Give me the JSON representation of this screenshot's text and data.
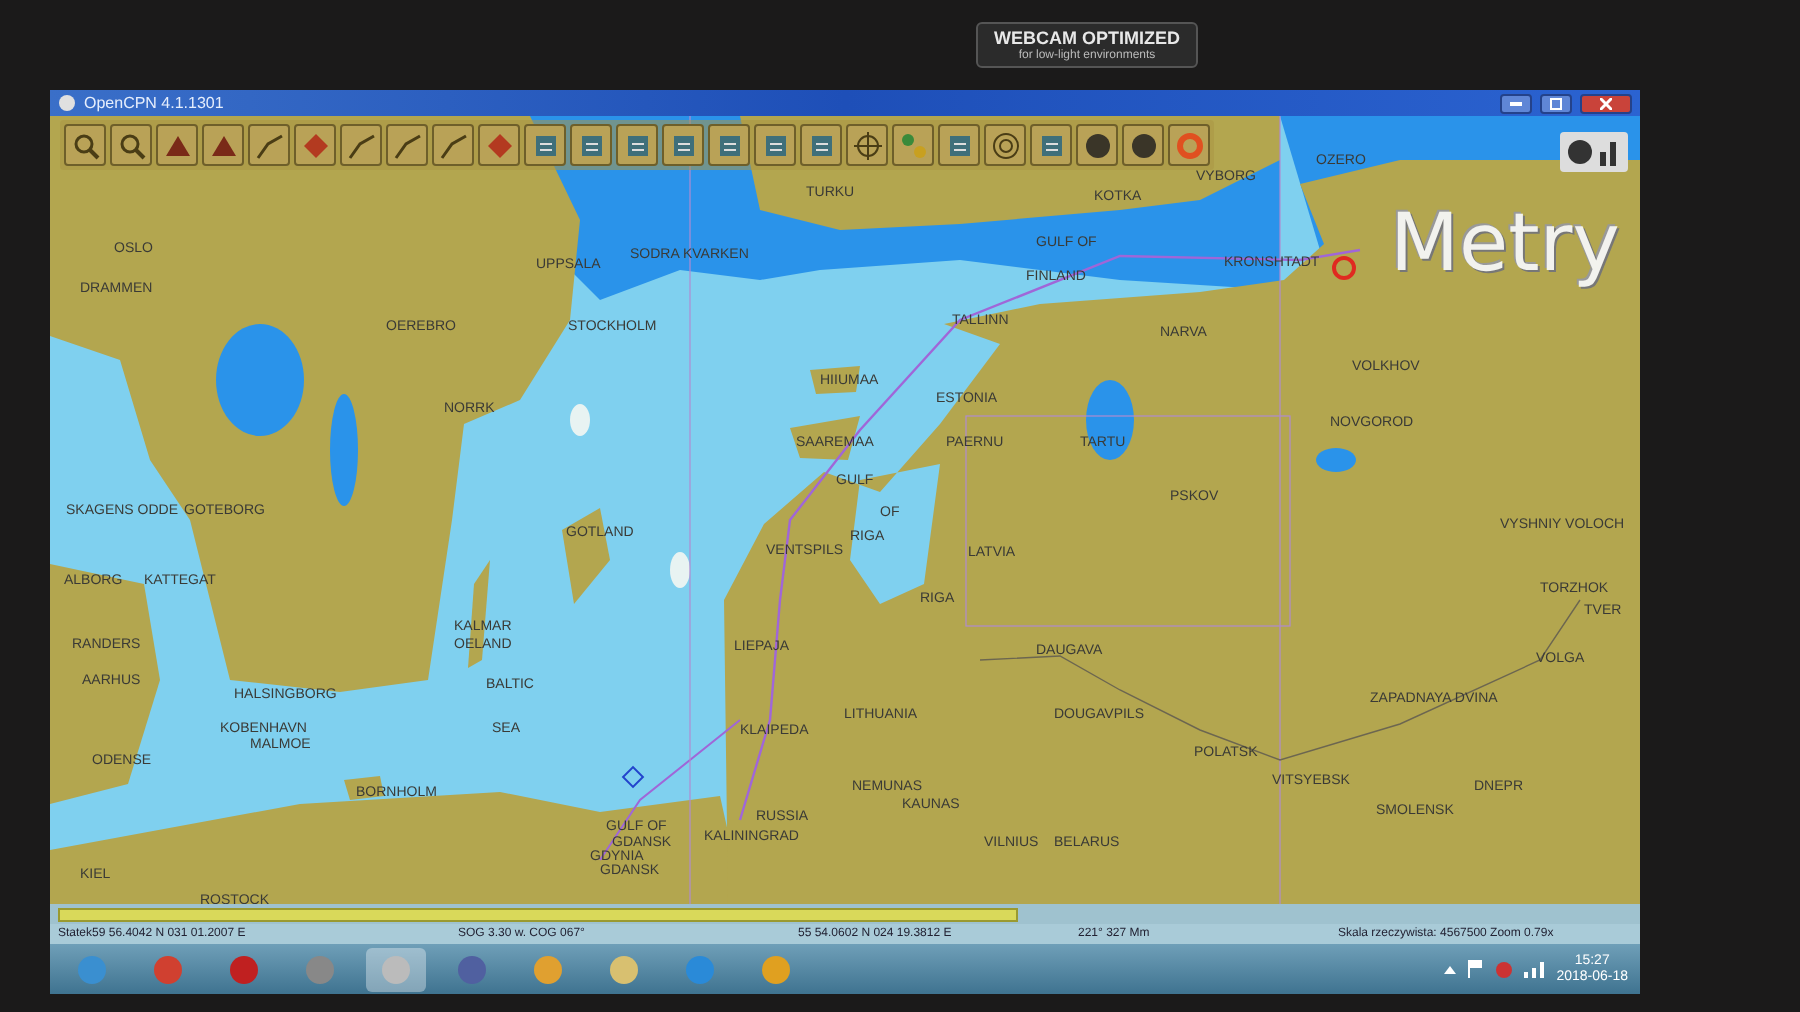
{
  "bezel": {
    "label": "WEBCAM OPTIMIZED",
    "sublabel": "for low-light environments"
  },
  "window": {
    "title": "OpenCPN 4.1.1301"
  },
  "map": {
    "overlay": "Metry",
    "labels": [
      {
        "text": "OZERO"
      },
      {
        "text": "VYBORG"
      },
      {
        "text": "TURKU"
      },
      {
        "text": "KOTKA"
      },
      {
        "text": "GULF OF"
      },
      {
        "text": "OSLO"
      },
      {
        "text": "SODRA KVARKEN"
      },
      {
        "text": "KRONSHTADT"
      },
      {
        "text": "UPPSALA"
      },
      {
        "text": "FINLAND"
      },
      {
        "text": "DRAMMEN"
      },
      {
        "text": "TALLINN"
      },
      {
        "text": "OEREBRO"
      },
      {
        "text": "STOCKHOLM"
      },
      {
        "text": "NARVA"
      },
      {
        "text": "VOLKHOV"
      },
      {
        "text": "HIIUMAA"
      },
      {
        "text": "ESTONIA"
      },
      {
        "text": "NORRK"
      },
      {
        "text": "NOVGOROD"
      },
      {
        "text": "SAAREMAA"
      },
      {
        "text": "PAERNU"
      },
      {
        "text": "TARTU"
      },
      {
        "text": "GULF"
      },
      {
        "text": "PSKOV"
      },
      {
        "text": "SKAGENS ODDE"
      },
      {
        "text": "GOTEBORG"
      },
      {
        "text": "OF"
      },
      {
        "text": "VYSHNIY VOLOCH"
      },
      {
        "text": "GOTLAND"
      },
      {
        "text": "RIGA"
      },
      {
        "text": "VENTSPILS"
      },
      {
        "text": "LATVIA"
      },
      {
        "text": "ALBORG"
      },
      {
        "text": "KATTEGAT"
      },
      {
        "text": "TORZHOK"
      },
      {
        "text": "RIGA"
      },
      {
        "text": "TVER"
      },
      {
        "text": "KALMAR"
      },
      {
        "text": "RANDERS"
      },
      {
        "text": "OELAND"
      },
      {
        "text": "LIEPAJA"
      },
      {
        "text": "DAUGAVA"
      },
      {
        "text": "VOLGA"
      },
      {
        "text": "AARHUS"
      },
      {
        "text": "BALTIC"
      },
      {
        "text": "HALSINGBORG"
      },
      {
        "text": "ZAPADNAYA DVINA"
      },
      {
        "text": "LITHUANIA"
      },
      {
        "text": "DOUGAVPILS"
      },
      {
        "text": "KOBENHAVN"
      },
      {
        "text": "SEA"
      },
      {
        "text": "KLAIPEDA"
      },
      {
        "text": "MALMOE"
      },
      {
        "text": "POLATSK"
      },
      {
        "text": "ODENSE"
      },
      {
        "text": "VITSYEBSK"
      },
      {
        "text": "NEMUNAS"
      },
      {
        "text": "DNEPR"
      },
      {
        "text": "BORNHOLM"
      },
      {
        "text": "KAUNAS"
      },
      {
        "text": "SMOLENSK"
      },
      {
        "text": "RUSSIA"
      },
      {
        "text": "GULF OF"
      },
      {
        "text": "KALININGRAD"
      },
      {
        "text": "GDANSK"
      },
      {
        "text": "VILNIUS"
      },
      {
        "text": "BELARUS"
      },
      {
        "text": "GDYNIA"
      },
      {
        "text": "GDANSK"
      },
      {
        "text": "KIEL"
      },
      {
        "text": "ROSTOCK"
      }
    ]
  },
  "status_bar": {
    "fields": [
      "Statek59 56.4042 N 031 01.2007 E",
      "SOG 3.30 w. COG 067°",
      "55 54.0602 N 024 19.3812 E",
      "221° 327 Mm",
      "Skala rzeczywista: 4567500 Zoom 0.79x"
    ]
  },
  "taskbar": {
    "time": "15:27",
    "date": "2018-06-18"
  }
}
